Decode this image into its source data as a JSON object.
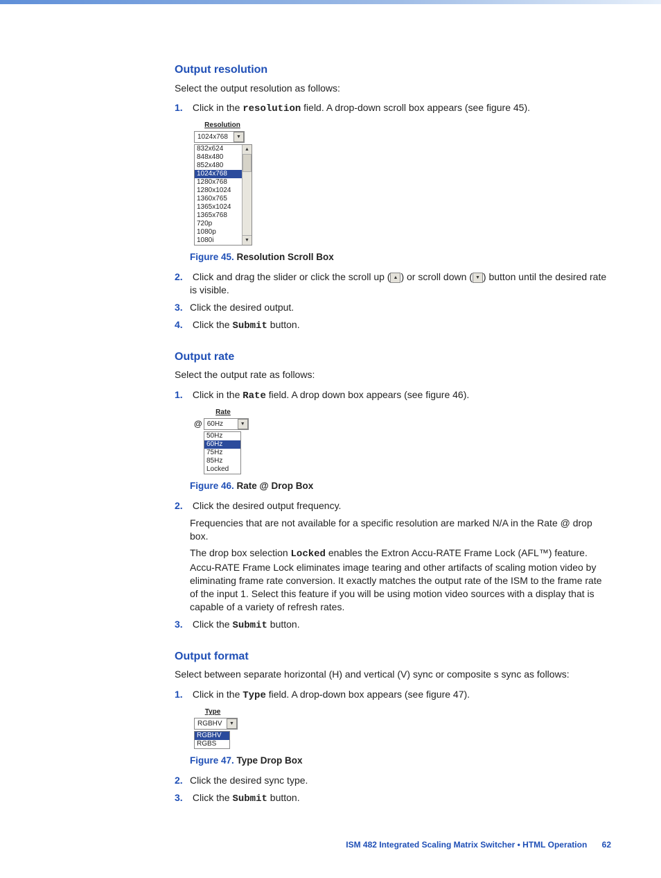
{
  "sections": {
    "resolution": {
      "heading": "Output resolution",
      "intro": "Select the output resolution as follows:",
      "step1_a": "Click in the ",
      "step1_code": "resolution",
      "step1_b": " field.  A drop-down scroll box appears (see figure 45).",
      "dropdown": {
        "label": "Resolution",
        "value": "1024x768",
        "options": [
          "832x624",
          "848x480",
          "852x480",
          "1024x768",
          "1280x768",
          "1280x1024",
          "1360x765",
          "1365x1024",
          "1365x768",
          "720p",
          "1080p",
          "1080i"
        ],
        "selected_index": 3
      },
      "fig_num": "Figure 45.",
      "fig_text": "  Resolution Scroll Box",
      "step2_a": "Click and drag the slider or click the scroll up (",
      "step2_b": ") or scroll down (",
      "step2_c": ") button until the desired rate is visible.",
      "step3": "Click the desired output.",
      "step4_a": "Click the ",
      "step4_code": "Submit",
      "step4_b": " button."
    },
    "rate": {
      "heading": "Output rate",
      "intro": "Select the output rate as follows:",
      "step1_a": "Click in the ",
      "step1_code": "Rate",
      "step1_b": " field.  A drop down box appears (see figure 46).",
      "dropdown": {
        "label": "Rate",
        "at": "@",
        "value": "60Hz",
        "options": [
          "50Hz",
          "60Hz",
          "75Hz",
          "85Hz",
          "Locked"
        ],
        "selected_index": 1
      },
      "fig_num": "Figure 46.",
      "fig_text": "   Rate @ Drop Box",
      "step2": "Click the desired output frequency.",
      "note1": "Frequencies that are not available for a specific resolution are marked N/A in the Rate @ drop box.",
      "note2_a": "The drop box selection ",
      "note2_code": "Locked",
      "note2_b": " enables the Extron Accu-RATE Frame Lock (AFL™) feature.  Accu-RATE Frame Lock eliminates image tearing and other artifacts of scaling motion video by eliminating frame rate conversion.  It exactly matches the output rate of the ISM to the frame rate of the input 1.  Select this feature if you will be using motion video sources with a display that is capable of a variety of refresh rates.",
      "step3_a": "Click the ",
      "step3_code": "Submit",
      "step3_b": " button."
    },
    "format": {
      "heading": "Output format",
      "intro": "Select between separate horizontal (H) and vertical (V) sync or composite s sync as follows:",
      "step1_a": "Click in the ",
      "step1_code": "Type",
      "step1_b": " field.  A drop-down box appears (see figure 47).",
      "dropdown": {
        "label": "Type",
        "value": "RGBHV",
        "options": [
          "RGBHV",
          "RGBS"
        ],
        "selected_index": 0
      },
      "fig_num": "Figure 47.",
      "fig_text": "   Type Drop Box",
      "step2": "Click the desired sync type.",
      "step3_a": "Click the ",
      "step3_code": "Submit",
      "step3_b": " button."
    }
  },
  "footer": {
    "title": "ISM 482 Integrated Scaling Matrix Switcher • HTML Operation",
    "page": "62"
  }
}
